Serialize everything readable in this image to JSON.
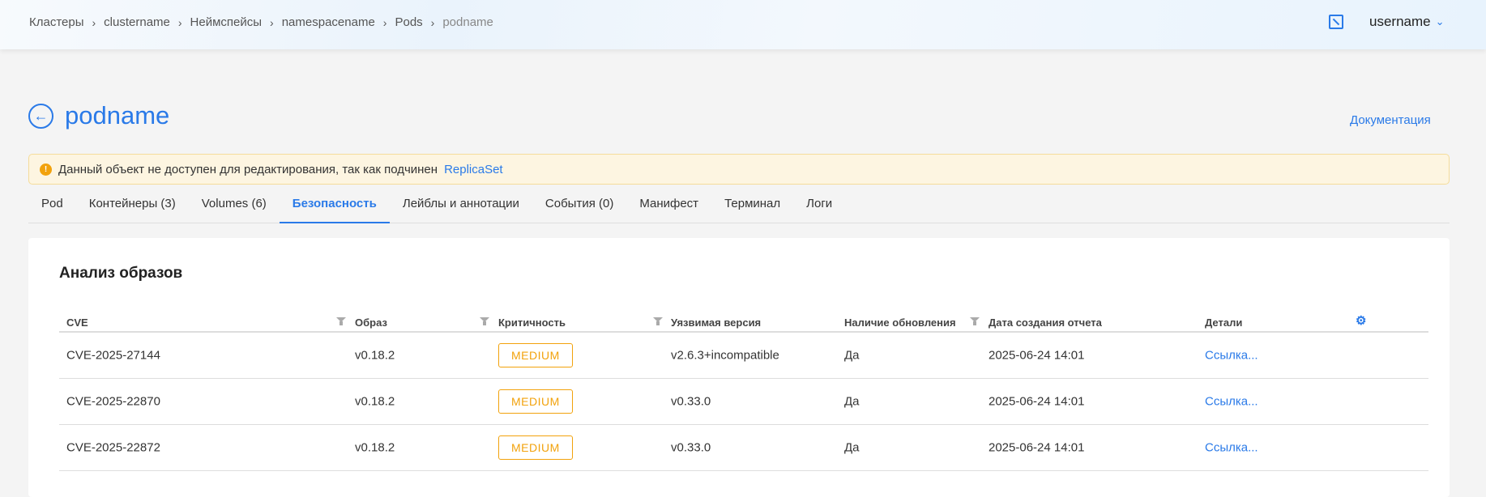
{
  "breadcrumbs": [
    "Кластеры",
    "clustername",
    "Неймспейсы",
    "namespacename",
    "Pods",
    "podname"
  ],
  "user": {
    "name": "username"
  },
  "page": {
    "title": "podname",
    "docs_link": "Документация"
  },
  "alert": {
    "text": "Данный объект не доступен для редактирования, так как подчинен",
    "link": "ReplicaSet"
  },
  "tabs": [
    {
      "label": "Pod"
    },
    {
      "label": "Контейнеры (3)"
    },
    {
      "label": "Volumes (6)"
    },
    {
      "label": "Безопасность"
    },
    {
      "label": "Лейблы и аннотации"
    },
    {
      "label": "События (0)"
    },
    {
      "label": "Манифест"
    },
    {
      "label": "Терминал"
    },
    {
      "label": "Логи"
    }
  ],
  "section": {
    "title": "Анализ образов"
  },
  "table": {
    "headers": [
      "CVE",
      "Образ",
      "Критичность",
      "Уязвимая версия",
      "Наличие обновления",
      "Дата создания отчета",
      "Детали"
    ],
    "rows": [
      [
        "CVE-2025-27144",
        "v0.18.2",
        "MEDIUM",
        "v2.6.3+incompatible",
        "Да",
        "2025-06-24 14:01",
        "Ссылка..."
      ],
      [
        "CVE-2025-22870",
        "v0.18.2",
        "MEDIUM",
        "v0.33.0",
        "Да",
        "2025-06-24 14:01",
        "Ссылка..."
      ],
      [
        "CVE-2025-22872",
        "v0.18.2",
        "MEDIUM",
        "v0.33.0",
        "Да",
        "2025-06-24 14:01",
        "Ссылка..."
      ]
    ]
  },
  "colors": {
    "accent": "#2a7ae8",
    "warning": "#f2a20c"
  }
}
